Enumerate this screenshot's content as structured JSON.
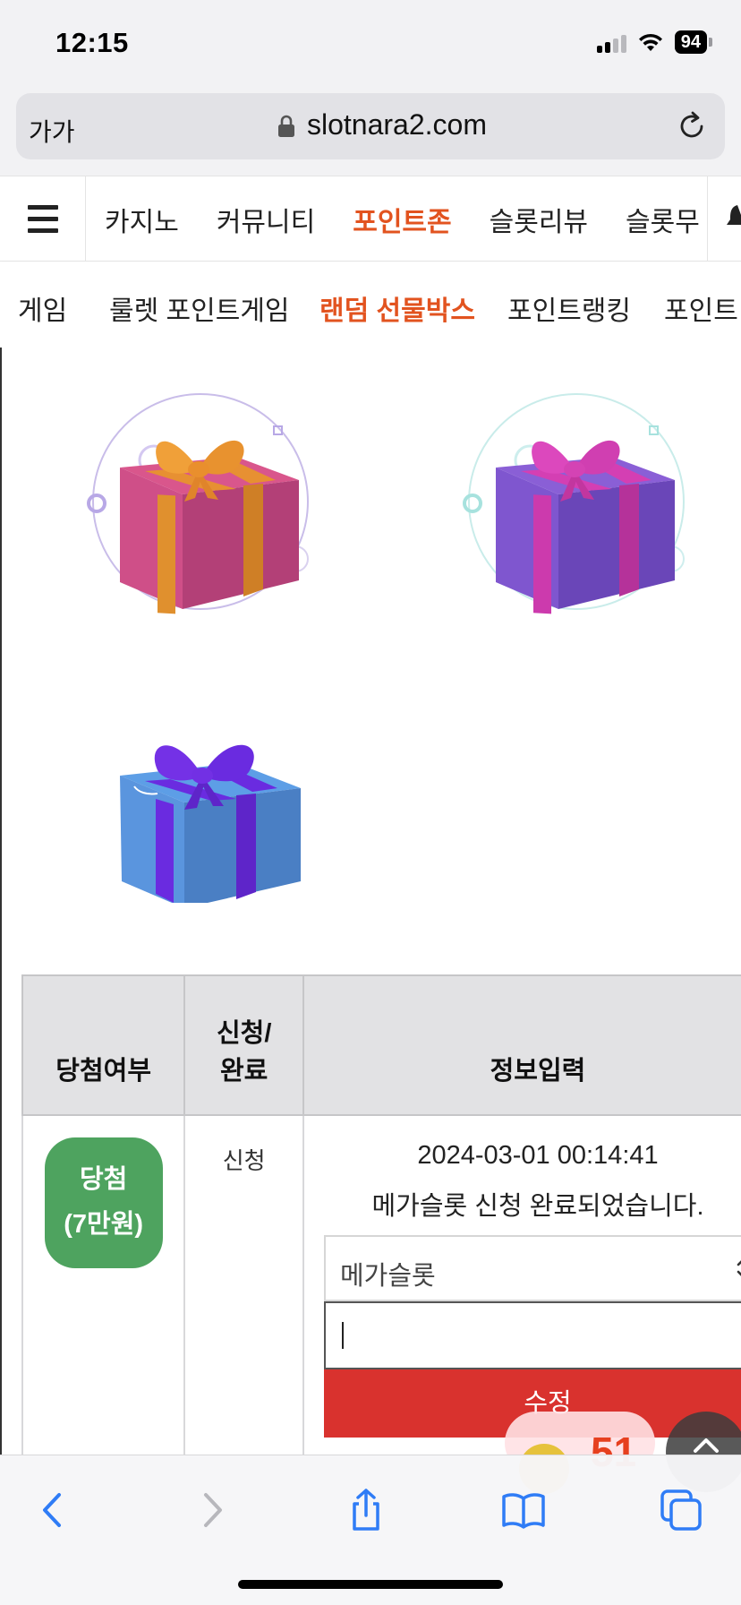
{
  "status_bar": {
    "time": "12:15",
    "battery": "94"
  },
  "browser": {
    "reader_label": "가가",
    "domain": "slotnara2.com"
  },
  "nav_primary": {
    "items": [
      {
        "label": "카지노"
      },
      {
        "label": "커뮤니티"
      },
      {
        "label": "포인트존",
        "active": true
      },
      {
        "label": "슬롯리뷰"
      },
      {
        "label": "슬롯무"
      }
    ]
  },
  "nav_secondary": {
    "items": [
      {
        "label": "게임"
      },
      {
        "label": "룰렛 포인트게임"
      },
      {
        "label": "랜덤 선물박스",
        "active": true
      },
      {
        "label": "포인트랭킹"
      },
      {
        "label": "포인트"
      }
    ]
  },
  "gift_boxes": [
    {
      "color": "pink",
      "ribbon": "orange"
    },
    {
      "color": "purple",
      "ribbon": "magenta"
    },
    {
      "color": "blue",
      "ribbon": "violet"
    }
  ],
  "table": {
    "headers": {
      "win_status": "당첨여부",
      "apply_line1": "신청/",
      "apply_line2": "완료",
      "info_input": "정보입력"
    },
    "row": {
      "badge_line1": "당첨",
      "badge_line2": "(7만원)",
      "status": "신청",
      "datetime": "2024-03-01 00:14:41",
      "message": "메가슬롯 신청 완료되었습니다.",
      "select_value": "메가슬롯",
      "input_value": "",
      "button_label": "수정"
    }
  },
  "floating": {
    "points": "51"
  },
  "colors": {
    "accent": "#e2531f",
    "win_badge": "#4ea35f",
    "edit_button": "#d9322e"
  }
}
